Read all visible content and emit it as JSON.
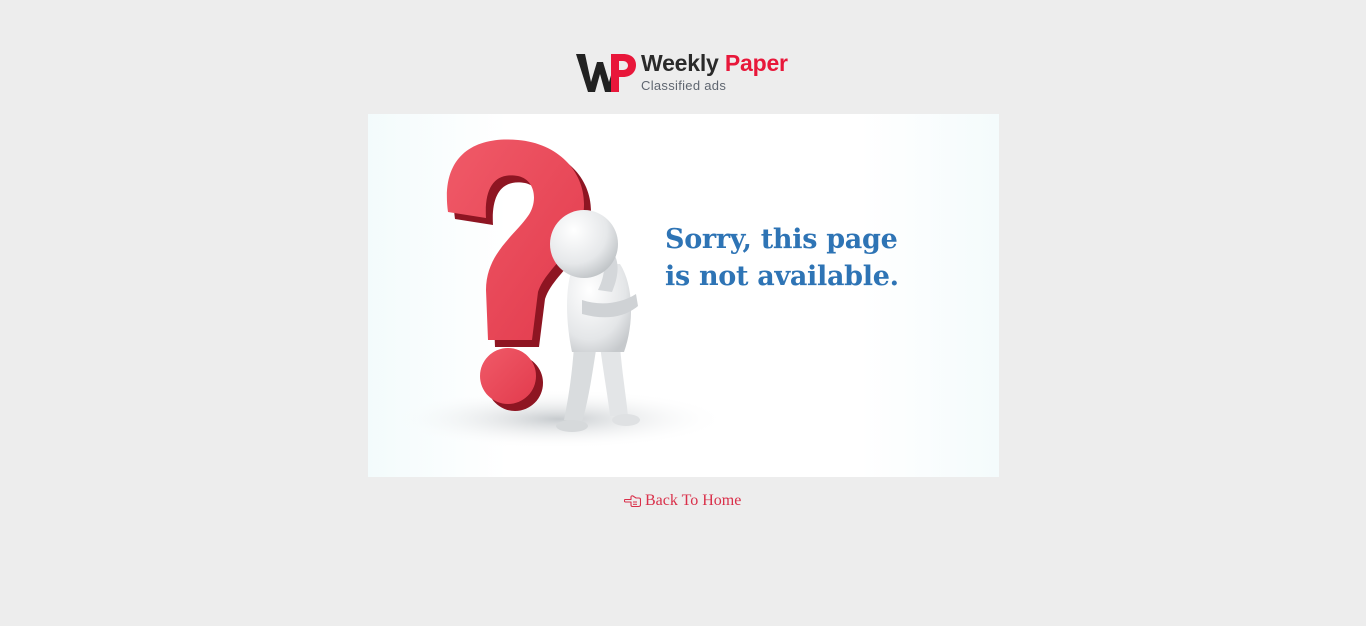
{
  "logo": {
    "brand_first": "Weekly",
    "brand_second": "Paper",
    "tagline": "Classified ads",
    "colors": {
      "dark": "#2a2a2a",
      "red": "#e8173a"
    }
  },
  "error": {
    "message_line1": "Sorry, this page",
    "message_line2": "is not available.",
    "message_color": "#2e74b5",
    "illustration": "question-mark-thinking-figure"
  },
  "back_link": {
    "icon": "pointing-hand-left-icon",
    "label": "Back To Home",
    "color": "#d9304a"
  }
}
